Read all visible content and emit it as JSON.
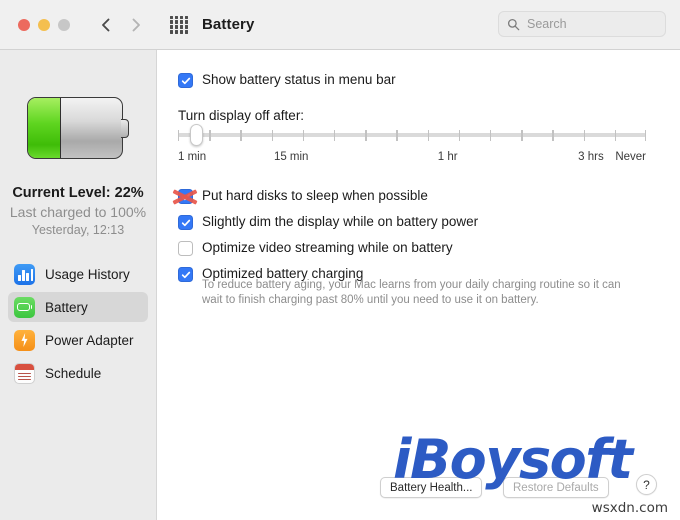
{
  "window": {
    "title": "Battery",
    "traffic_lights": [
      "close",
      "minimize",
      "zoom"
    ],
    "back_icon": "chevron-left-icon",
    "forward_icon": "chevron-right-icon",
    "grid_icon": "grid-apps-icon"
  },
  "search": {
    "placeholder": "Search",
    "icon": "search-icon",
    "value": ""
  },
  "sidebar": {
    "battery_graphic": {
      "icon": "battery-icon",
      "fill_percent": 35,
      "fill_color": "#4ec61a"
    },
    "current_level": "Current Level: 22%",
    "last_charged": "Last charged to 100%",
    "last_charged_time": "Yesterday, 12:13",
    "items": [
      {
        "label": "Usage History",
        "icon": "usage-history-icon",
        "color": "#2b7ff0",
        "selected": false
      },
      {
        "label": "Battery",
        "icon": "battery-icon",
        "color": "#4ecb4a",
        "selected": true
      },
      {
        "label": "Power Adapter",
        "icon": "power-bolt-icon",
        "color": "#f79d23",
        "selected": false
      },
      {
        "label": "Schedule",
        "icon": "calendar-icon",
        "color": "#d8503f",
        "selected": false
      }
    ]
  },
  "main": {
    "menubar_checkbox": {
      "label": "Show battery status in menu bar",
      "checked": true
    },
    "slider": {
      "label": "Turn display off after:",
      "value_position_percent": 4,
      "tick_count": 16,
      "tick_labels": [
        "1 min",
        "15 min",
        "1 hr",
        "3 hrs",
        "Never"
      ]
    },
    "options": [
      {
        "label": "Put hard disks to sleep when possible",
        "checked": true,
        "annotated_with_red_x": true
      },
      {
        "label": "Slightly dim the display while on battery power",
        "checked": true,
        "annotated_with_red_x": false
      },
      {
        "label": "Optimize video streaming while on battery",
        "checked": false,
        "annotated_with_red_x": false
      },
      {
        "label": "Optimized battery charging",
        "checked": true,
        "annotated_with_red_x": false
      }
    ],
    "help_text": "To reduce battery aging, your Mac learns from your daily charging routine so it can wait to finish charging past 80% until you need to use it on battery."
  },
  "footer": {
    "battery_health_label": "Battery Health...",
    "restore_defaults_label": "Restore Defaults",
    "help_label": "?"
  },
  "watermarks": {
    "brand": "iBoysoft",
    "brand_color": "#2d5bc4",
    "site": "wsxdn.com"
  }
}
